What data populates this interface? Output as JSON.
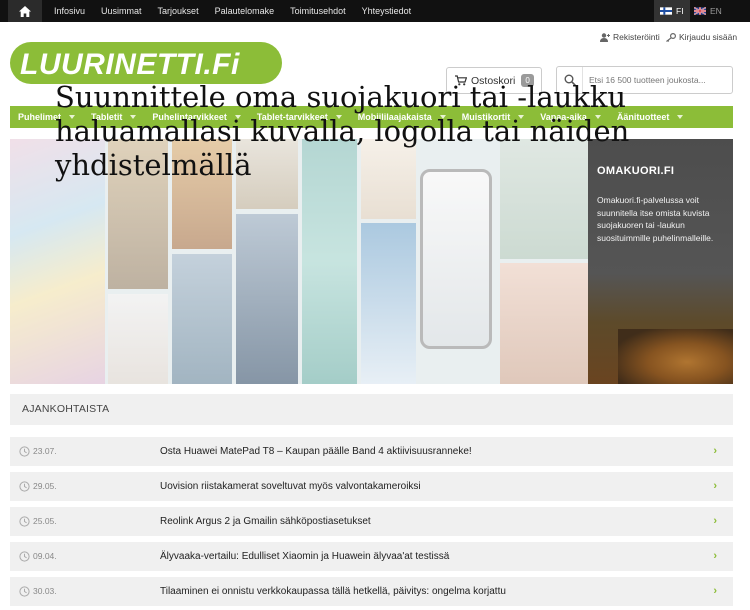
{
  "topbar": {
    "home_icon": "home-icon",
    "links": [
      "Infosivu",
      "Uusimmat",
      "Tarjoukset",
      "Palautelomake",
      "Toimitusehdot",
      "Yhteystiedot"
    ],
    "lang_fi": "FI",
    "lang_en": "EN"
  },
  "header": {
    "logo_text": "LUURINETTI.Fi",
    "register": "Rekisteröinti",
    "login": "Kirjaudu sisään",
    "cart_label": "Ostoskori",
    "cart_count": "0",
    "search_placeholder": "Etsi 16 500 tuotteen joukosta..."
  },
  "categories": [
    "Puhelimet",
    "Tabletit",
    "Puhelintarvikkeet",
    "Tablet-tarvikkeet",
    "Mobiililaajakaista",
    "Muistikortit",
    "Vapaa-aika",
    "Äänituotteet"
  ],
  "banner": {
    "headline": "Suunnittele oma suojakuori tai -laukku haluamallasi kuvalla, logolla tai näiden yhdistelmällä"
  },
  "side_panel": {
    "title": "OMAKUORI.FI",
    "text": "Omakuori.fi-palvelussa voit suunnitella itse omista kuvista suojakuoren tai -laukun suosituimmille puhelinmalleille."
  },
  "news": {
    "heading": "AJANKOHTAISTA",
    "items": [
      {
        "date": "23.07.",
        "title": "Osta Huawei MatePad T8 – Kaupan päälle Band 4 aktiivisuusranneke!"
      },
      {
        "date": "29.05.",
        "title": "Uovision riistakamerat soveltuvat myös valvontakameroiksi"
      },
      {
        "date": "25.05.",
        "title": "Reolink Argus 2 ja Gmailin sähköpostiasetukset"
      },
      {
        "date": "09.04.",
        "title": "Älyvaaka-vertailu: Edulliset Xiaomin ja Huawein älyvaa'at testissä"
      },
      {
        "date": "30.03.",
        "title": "Tilaaminen ei onnistu verkkokaupassa tällä hetkellä, päivitys: ongelma korjattu"
      }
    ]
  },
  "colors": {
    "brand_green": "#8cbd38",
    "topbar_black": "#111111",
    "news_bg": "#f0f0f0"
  }
}
